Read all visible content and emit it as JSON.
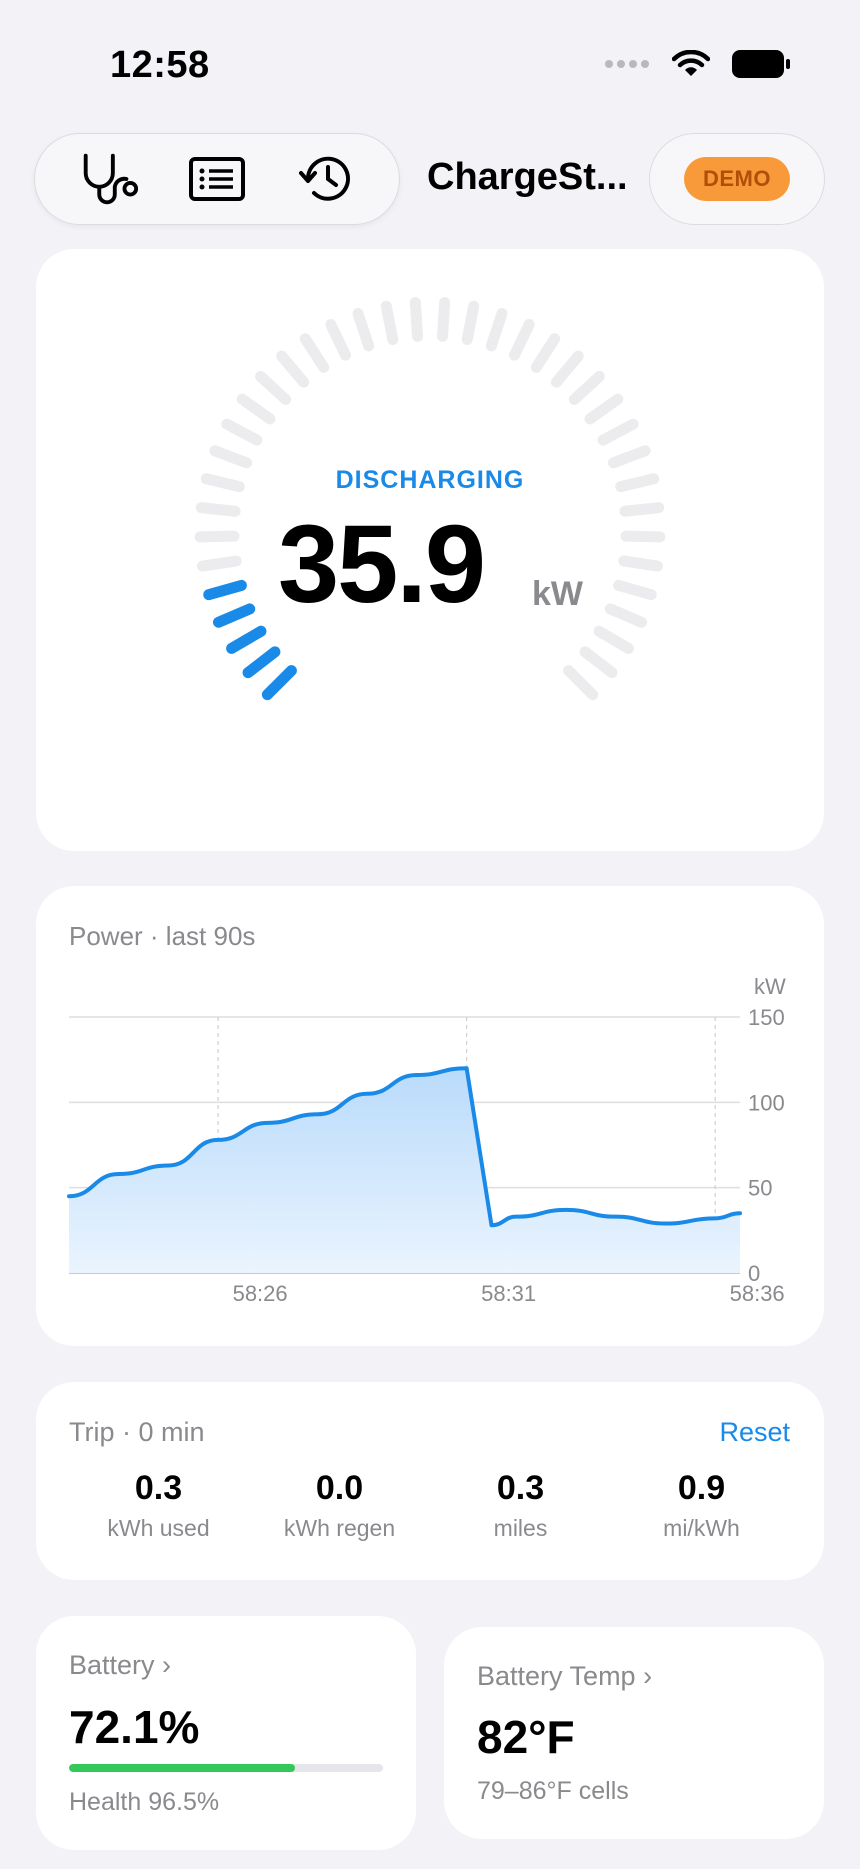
{
  "status_bar": {
    "time": "12:58"
  },
  "toolbar": {
    "app_title": "ChargeSt...",
    "demo_badge": "DEMO",
    "icons": [
      "stethoscope-icon",
      "list-icon",
      "history-icon"
    ]
  },
  "gauge": {
    "state": "DISCHARGING",
    "value": "35.9",
    "unit": "kW",
    "level_fraction": 0.12,
    "active_color": "#1a8ae8"
  },
  "power_chart": {
    "title": "Power · last 90s",
    "unit_label": "kW"
  },
  "chart_data": {
    "type": "area",
    "x": [
      "58:23",
      "58:24",
      "58:25",
      "58:26",
      "58:27",
      "58:28",
      "58:29",
      "58:30",
      "58:31",
      "58:31.5",
      "58:32",
      "58:33",
      "58:34",
      "58:35",
      "58:36",
      "58:36.5"
    ],
    "y": [
      45,
      58,
      63,
      78,
      88,
      93,
      105,
      116,
      120,
      28,
      33,
      37,
      33,
      29,
      32,
      35
    ],
    "xticks": [
      "58:26",
      "58:31",
      "58:36"
    ],
    "yticks": [
      "0",
      "50",
      "100",
      "150"
    ],
    "ylim": [
      0,
      150
    ],
    "ylabel": "kW",
    "color": "#1a8ae8"
  },
  "trip": {
    "title": "Trip · 0 min",
    "reset_label": "Reset",
    "stats": [
      {
        "value": "0.3",
        "label": "kWh used"
      },
      {
        "value": "0.0",
        "label": "kWh regen"
      },
      {
        "value": "0.3",
        "label": "miles"
      },
      {
        "value": "0.9",
        "label": "mi/kWh"
      }
    ]
  },
  "battery": {
    "title": "Battery ›",
    "value": "72.1%",
    "level_fraction": 0.721,
    "health": "Health 96.5%",
    "bar_color": "#34c759"
  },
  "battery_temp": {
    "title": "Battery Temp ›",
    "value": "82°F",
    "range": "79–86°F cells"
  }
}
